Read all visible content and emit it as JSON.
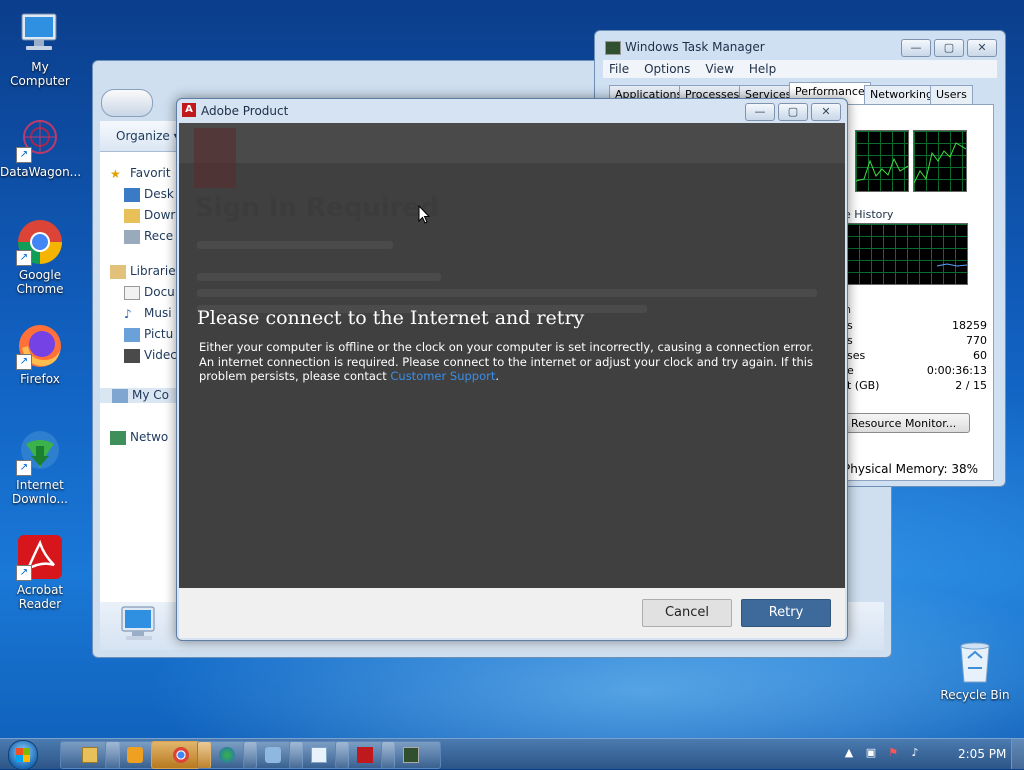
{
  "desktop": {
    "icons": [
      {
        "label": "My Computer",
        "icon": "computer-icon"
      },
      {
        "label": "DataWagon...",
        "icon": "datawagon-icon"
      },
      {
        "label": "Google Chrome",
        "icon": "chrome-icon"
      },
      {
        "label": "Firefox",
        "icon": "firefox-icon"
      },
      {
        "label": "Internet Downlo...",
        "icon": "idm-icon"
      },
      {
        "label": "Acrobat Reader",
        "icon": "acrobat-icon"
      },
      {
        "label": "Recycle Bin",
        "icon": "recycle-bin-icon"
      }
    ]
  },
  "explorer": {
    "organize": "Organize ▾",
    "nav": [
      {
        "label": "Favorit",
        "icon": "star-icon"
      },
      {
        "label": "Desk",
        "icon": "desktop-folder-icon"
      },
      {
        "label": "Dowr",
        "icon": "downloads-folder-icon"
      },
      {
        "label": "Rece",
        "icon": "recent-places-icon"
      },
      {
        "label": "Librarie",
        "icon": "libraries-icon"
      },
      {
        "label": "Docu",
        "icon": "documents-icon"
      },
      {
        "label": "Musi",
        "icon": "music-icon"
      },
      {
        "label": "Pictu",
        "icon": "pictures-icon"
      },
      {
        "label": "Videc",
        "icon": "videos-icon"
      },
      {
        "label": "My Co",
        "icon": "computer-icon"
      },
      {
        "label": "Netwo",
        "icon": "network-icon"
      }
    ]
  },
  "taskmgr": {
    "title": "Windows Task Manager",
    "menu": [
      "File",
      "Options",
      "View",
      "Help"
    ],
    "tabs": [
      "Applications",
      "Processes",
      "Services",
      "Performance",
      "Networking",
      "Users"
    ],
    "active_tab": "Performance",
    "history_label": "e History",
    "system_label": "n",
    "stats": [
      {
        "key": "s",
        "value": "18259"
      },
      {
        "key": "s",
        "value": "770"
      },
      {
        "key": "ses",
        "value": "60"
      },
      {
        "key": "e",
        "value": "0:00:36:13"
      },
      {
        "key": "t (GB)",
        "value": "2 / 15"
      }
    ],
    "resource_monitor": "Resource Monitor...",
    "status": "Physical Memory: 38%"
  },
  "adobe": {
    "title": "Adobe Product",
    "logo": "A",
    "background_heading": "Sign In Required",
    "heading": "Please connect to the Internet and retry",
    "message_text": "Either your computer is offline or the clock on your computer is set incorrectly, causing a connection error. An internet connection is required. Please connect to the internet or adjust your clock and try again. If this problem persists, please contact ",
    "support_link": "Customer Support",
    "message_end": ".",
    "cancel": "Cancel",
    "retry": "Retry"
  },
  "taskbar": {
    "clock": "2:05 PM",
    "pinned": [
      "explorer-icon",
      "media-player-icon",
      "chrome-icon",
      "network-icon",
      "control-panel-icon",
      "notepad-icon",
      "adobe-icon",
      "task-manager-icon"
    ],
    "active": "chrome-icon"
  },
  "colors": {
    "dialog_bg": "#404040",
    "retry_button": "#3e6a9b",
    "link": "#3a8fe6",
    "adobe_red": "#c0191d"
  }
}
